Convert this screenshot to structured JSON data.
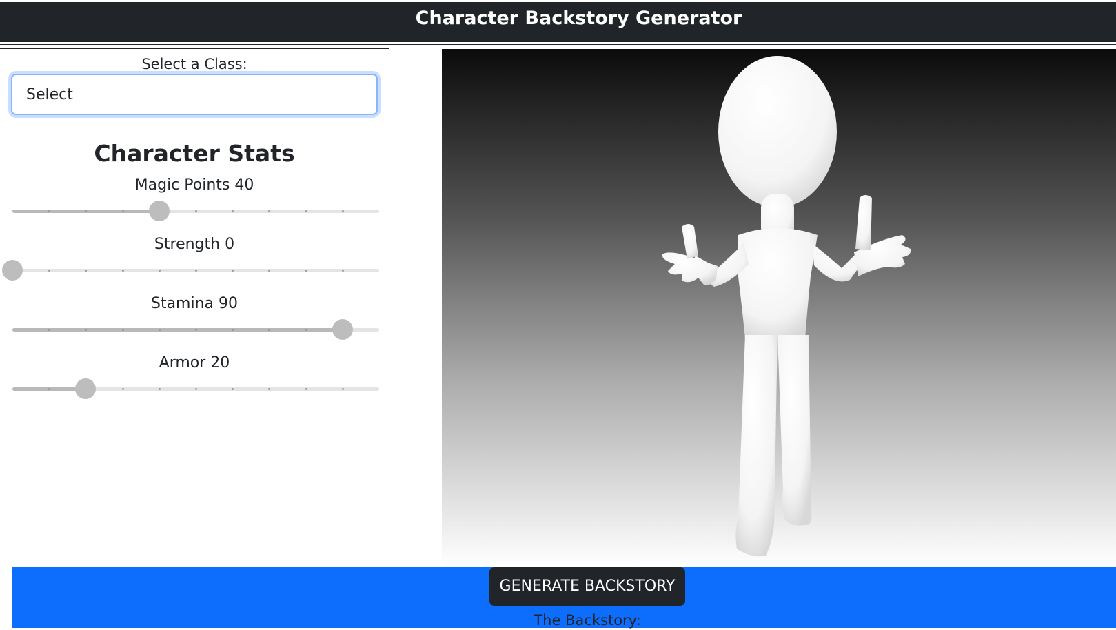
{
  "header": {
    "title": "Character Backstory Generator"
  },
  "class_select": {
    "label": "Select a Class:",
    "value": "Select"
  },
  "stats": {
    "title": "Character Stats",
    "items": [
      {
        "name": "Magic Points",
        "value": 40,
        "display": "Magic Points 40"
      },
      {
        "name": "Strength",
        "value": 0,
        "display": "Strength 0"
      },
      {
        "name": "Stamina",
        "value": 90,
        "display": "Stamina 90"
      },
      {
        "name": "Armor",
        "value": 20,
        "display": "Armor 20"
      }
    ],
    "max": 100
  },
  "viewport": {
    "model": "stick-figure-shrug"
  },
  "actions": {
    "generate_label": "GENERATE BACKSTORY"
  },
  "backstory": {
    "label": "The Backstory:"
  },
  "colors": {
    "header_bg": "#212529",
    "band_blue": "#0d6efd",
    "button_bg": "#212529",
    "slider_thumb": "#bdbdbd",
    "focus_border": "#86b7fe"
  }
}
